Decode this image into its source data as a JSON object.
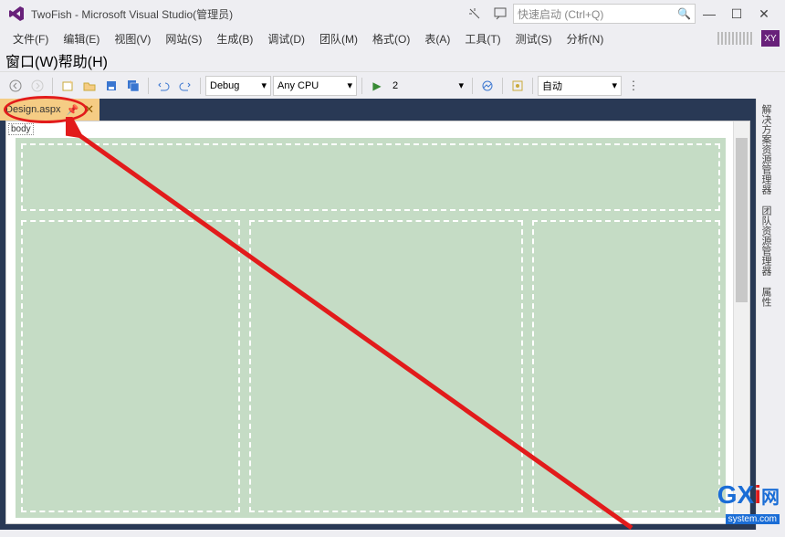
{
  "titlebar": {
    "app_title": "TwoFish - Microsoft Visual Studio(管理员)",
    "search_placeholder": "快速启动 (Ctrl+Q)"
  },
  "menubar": {
    "items": [
      "文件(F)",
      "编辑(E)",
      "视图(V)",
      "网站(S)",
      "生成(B)",
      "调试(D)",
      "团队(M)",
      "格式(O)",
      "表(A)",
      "工具(T)",
      "测试(S)",
      "分析(N)"
    ],
    "xy_label": "XY"
  },
  "menubar2": {
    "items": [
      "窗口(W)",
      "帮助(H)"
    ]
  },
  "toolbar": {
    "config": "Debug",
    "platform": "Any CPU",
    "run_label": "2",
    "auto_label": "自动"
  },
  "docwell": {
    "tab_label": "Design.aspx",
    "body_tag": "body"
  },
  "sidepanel": {
    "tabs": [
      "解决方案资源管理器",
      "团队资源管理器",
      "属性"
    ]
  },
  "watermark": {
    "brand": "GXI网",
    "url": "system.com"
  }
}
